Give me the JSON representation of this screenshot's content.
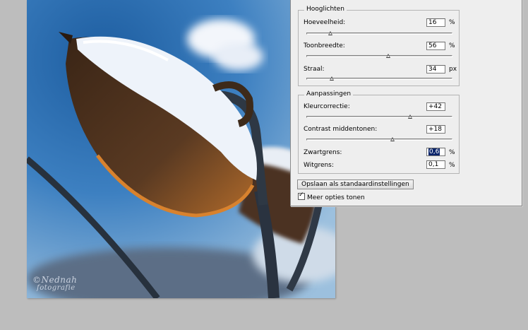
{
  "watermark": {
    "line1": "©Nednah",
    "line2": "fotografie"
  },
  "highlights": {
    "title": "Hooglichten",
    "rows": [
      {
        "label": "Hoeveelheid:",
        "value": "16",
        "unit": "%",
        "level": 0.16
      },
      {
        "label": "Toonbreedte:",
        "value": "56",
        "unit": "%",
        "level": 0.56
      },
      {
        "label": "Straal:",
        "value": "34",
        "unit": "px",
        "level": 0.17
      }
    ]
  },
  "adjustments": {
    "title": "Aanpassingen",
    "rows": [
      {
        "label": "Kleurcorrectie:",
        "value": "+42",
        "unit": "",
        "level": 0.71
      },
      {
        "label": "Contrast middentonen:",
        "value": "+18",
        "unit": "",
        "level": 0.59
      },
      {
        "label": "Zwartgrens:",
        "value": "0,6",
        "unit": "%",
        "selected": true
      },
      {
        "label": "Witgrens:",
        "value": "0,1",
        "unit": "%"
      }
    ]
  },
  "buttons": {
    "save_defaults": "Opslaan als standaardinstellingen"
  },
  "options": {
    "more_options": "Meer opties tonen",
    "more_options_checked": true
  }
}
